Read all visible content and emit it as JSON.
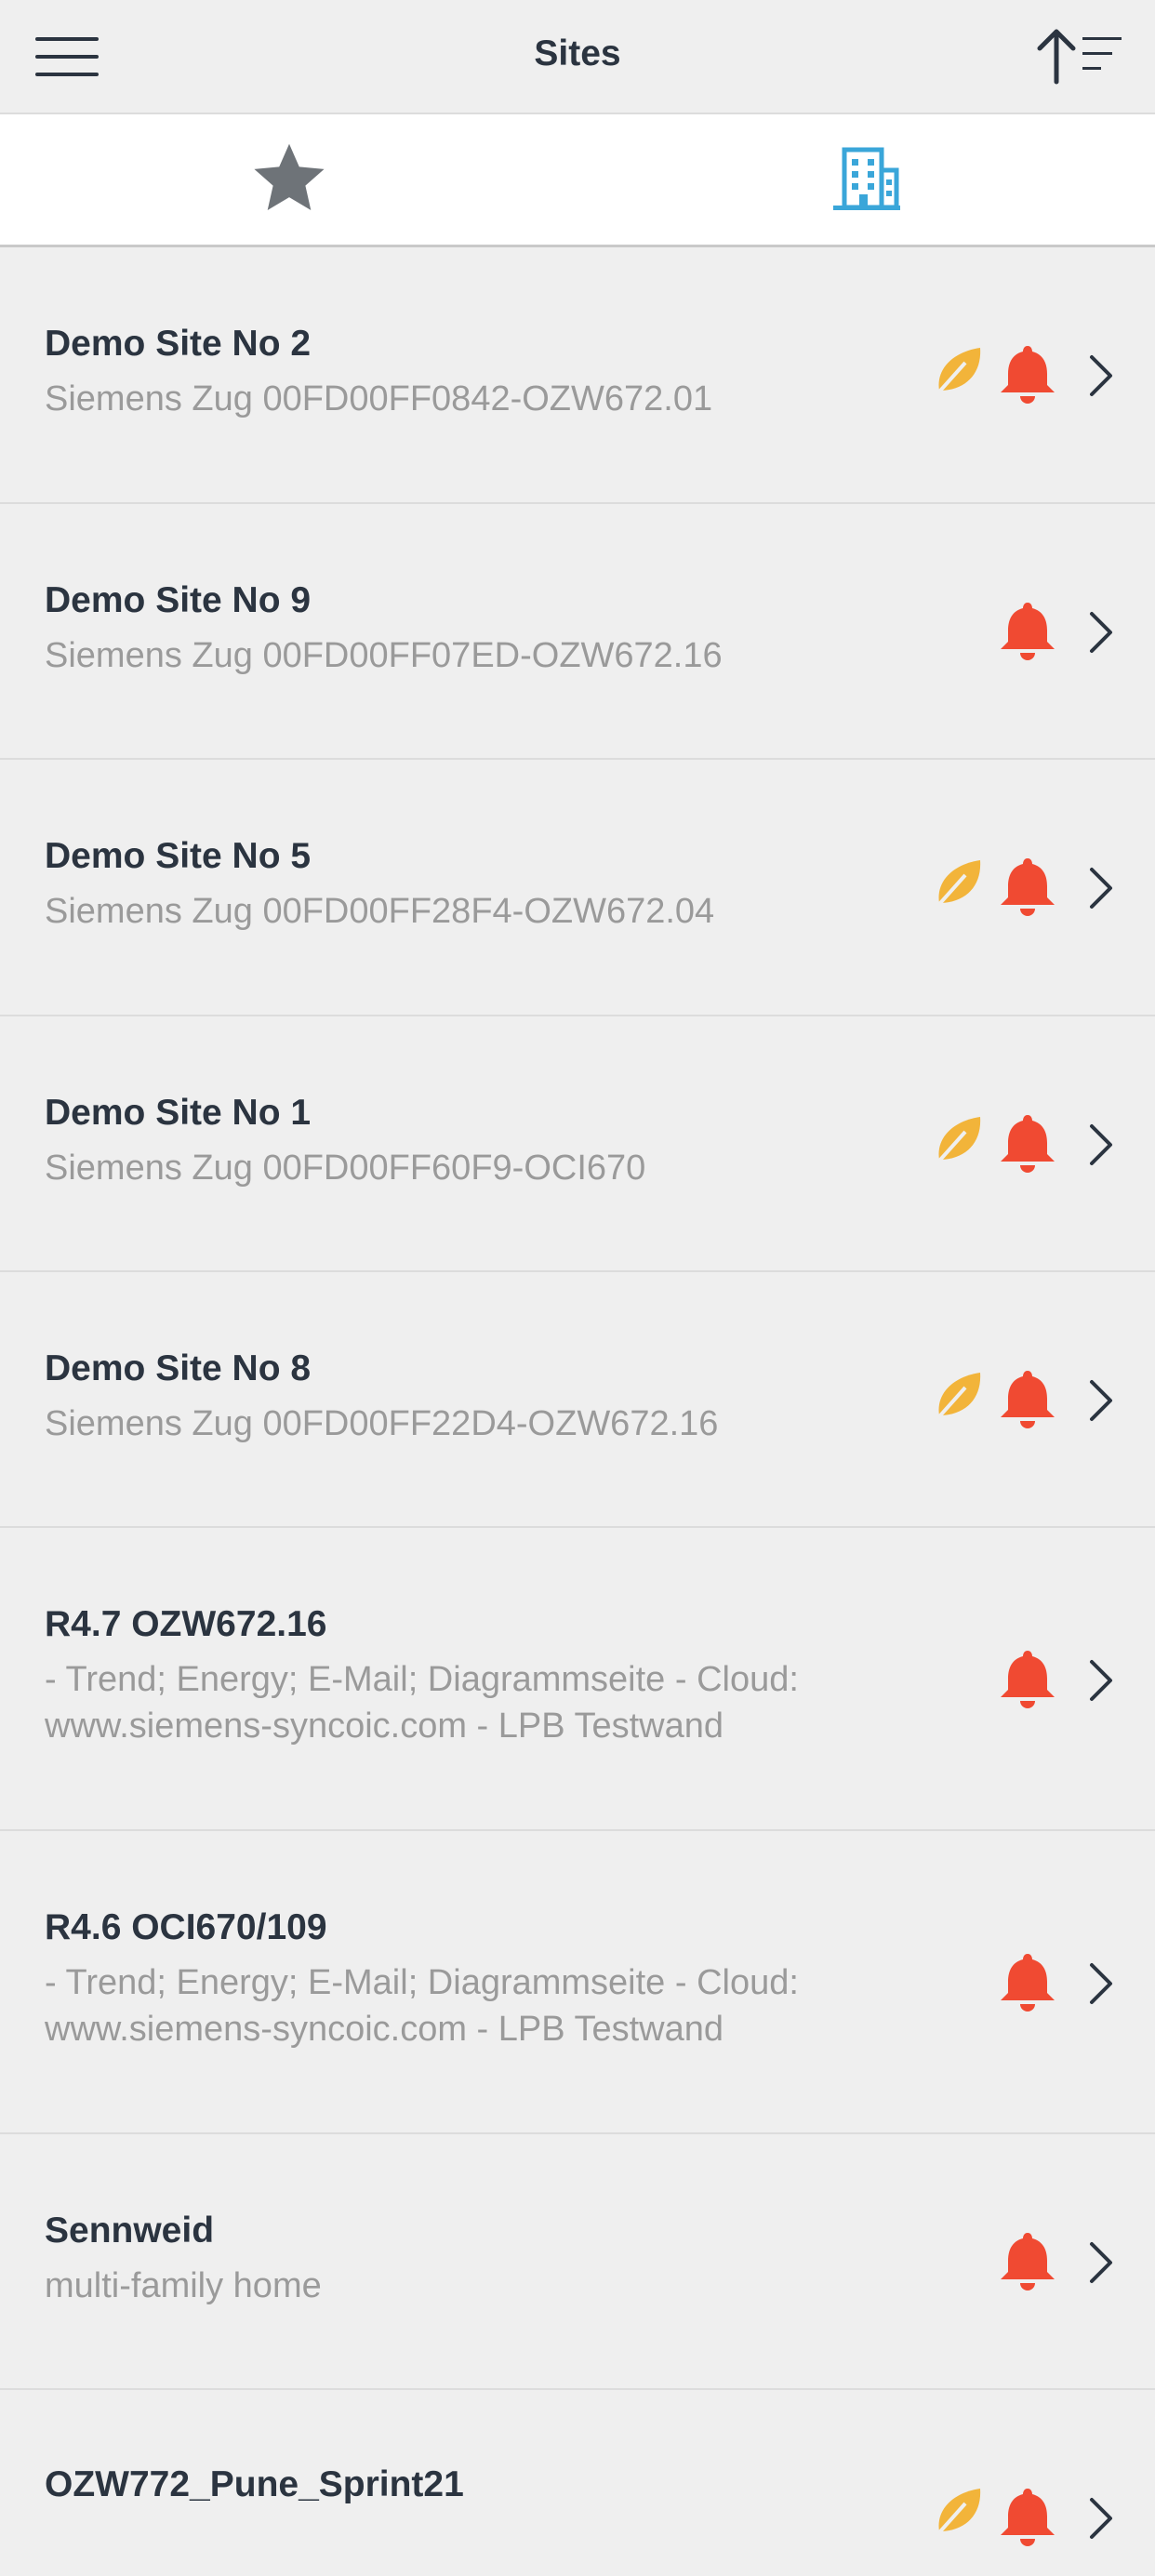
{
  "header": {
    "title": "Sites",
    "menu_icon": "hamburger-menu-icon",
    "sort_icon": "sort-ascending-icon"
  },
  "tabs": [
    {
      "name": "favorites",
      "icon": "star-icon",
      "color": "#6e7378",
      "selected": false
    },
    {
      "name": "sites",
      "icon": "building-icon",
      "color": "#3aa6d9",
      "selected": true
    }
  ],
  "colors": {
    "alarm": "#f04a32",
    "energy": "#f2b43a",
    "chevron": "#2b3440"
  },
  "sites": [
    {
      "name": "Demo Site No 2",
      "desc": "Siemens Zug 00FD00FF0842-OZW672.01",
      "energy": true,
      "alarm": true
    },
    {
      "name": "Demo Site No 9",
      "desc": "Siemens Zug 00FD00FF07ED-OZW672.16",
      "energy": false,
      "alarm": true
    },
    {
      "name": "Demo Site No 5",
      "desc": "Siemens Zug 00FD00FF28F4-OZW672.04",
      "energy": true,
      "alarm": true
    },
    {
      "name": "Demo Site No 1",
      "desc": "Siemens Zug 00FD00FF60F9-OCI670",
      "energy": true,
      "alarm": true
    },
    {
      "name": "Demo Site No 8",
      "desc": "Siemens Zug 00FD00FF22D4-OZW672.16",
      "energy": true,
      "alarm": true
    },
    {
      "name": "R4.7 OZW672.16",
      "desc": "- Trend; Energy; E-Mail; Diagrammseite - Cloud: www.siemens-syncoic.com - LPB Testwand",
      "energy": false,
      "alarm": true
    },
    {
      "name": "R4.6 OCI670/109",
      "desc": "- Trend; Energy; E-Mail; Diagrammseite - Cloud: www.siemens-syncoic.com - LPB Testwand",
      "energy": false,
      "alarm": true
    },
    {
      "name": "Sennweid",
      "desc": "multi-family home",
      "energy": false,
      "alarm": true
    },
    {
      "name": "OZW772_Pune_Sprint21",
      "desc": "",
      "energy": true,
      "alarm": true
    }
  ]
}
